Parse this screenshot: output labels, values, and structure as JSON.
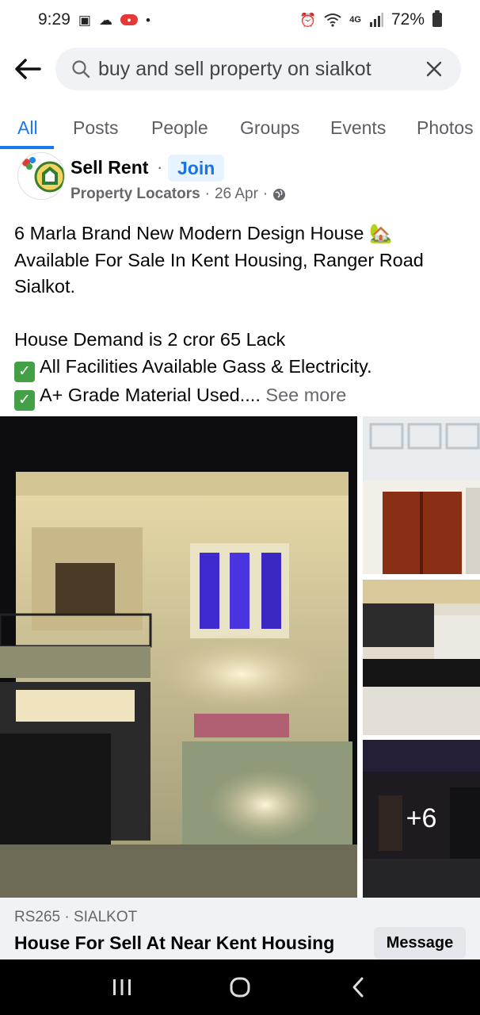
{
  "status_bar": {
    "time": "9:29",
    "network": "4G",
    "battery": "72%"
  },
  "search": {
    "query": "buy and sell property on sialkot"
  },
  "tabs": [
    {
      "label": "All",
      "active": true
    },
    {
      "label": "Posts",
      "active": false
    },
    {
      "label": "People",
      "active": false
    },
    {
      "label": "Groups",
      "active": false
    },
    {
      "label": "Events",
      "active": false
    },
    {
      "label": "Photos",
      "active": false
    }
  ],
  "post": {
    "author": "Sell Rent",
    "join_label": "Join",
    "group": "Property Locators",
    "date": "26 Apr",
    "text_lines": [
      "6 Marla Brand New Modern Design House",
      "Available For Sale In Kent Housing, Ranger Road",
      "Sialkot."
    ],
    "demand": "House Demand is 2 cror 65 Lack",
    "facility_1": "All Facilities Available Gass  &  Electricity.",
    "facility_2": "A+ Grade Material Used....",
    "see_more": "See more",
    "more_photos": "+6"
  },
  "listing": {
    "meta": "RS265 · SIALKOT",
    "title": "House For Sell At Near Kent Housing",
    "message_label": "Message"
  },
  "colors": {
    "accent": "#1877f2",
    "join_bg": "#e7f3ff",
    "secondary_text": "#65676b",
    "listing_bg": "#f0f2f5"
  }
}
